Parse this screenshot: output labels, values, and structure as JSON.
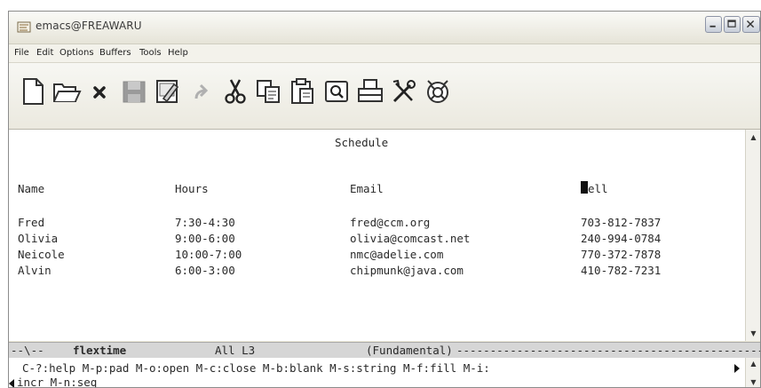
{
  "window": {
    "title": "emacs@FREAWARU"
  },
  "menu": {
    "items": [
      "File",
      "Edit",
      "Options",
      "Buffers",
      "Tools",
      "Help"
    ]
  },
  "toolbar": {
    "tools": [
      "new-file-icon",
      "open-folder-icon",
      "close-icon",
      "save-icon",
      "save-as-icon",
      "undo-icon",
      "cut-icon",
      "copy-icon",
      "paste-icon",
      "search-icon",
      "print-icon",
      "preferences-icon",
      "info-icon"
    ]
  },
  "buffer": {
    "title": "Schedule",
    "columns": [
      "Name",
      "Hours",
      "Email",
      "Cell"
    ],
    "cursor_char": "C",
    "cursor_rest": "ell",
    "rows": [
      [
        "Fred",
        "7:30-4:30",
        "fred@ccm.org",
        "703-812-7837"
      ],
      [
        "Olivia",
        "9:00-6:00",
        "olivia@comcast.net",
        "240-994-0784"
      ],
      [
        "Neicole",
        "10:00-7:00",
        "nmc@adelie.com",
        "770-372-7878"
      ],
      [
        "Alvin",
        "6:00-3:00",
        "chipmunk@java.com",
        "410-782-7231"
      ]
    ]
  },
  "modeline": {
    "prefix": "--\\--",
    "buffer_name": "flextime",
    "position": "All L3",
    "mode": "(Fundamental)",
    "fill": "----------------------------------------------"
  },
  "minibuffer": {
    "line1": "C-?:help M-p:pad M-o:open M-c:close M-b:blank M-s:string M-f:fill M-i:",
    "line2": "incr M-n:seq"
  },
  "colors": {
    "window_bg": "#ece9d8",
    "editor_bg": "#ffffff",
    "text": "#2a2a2a",
    "modeline_bg": "#d6d6d6"
  }
}
